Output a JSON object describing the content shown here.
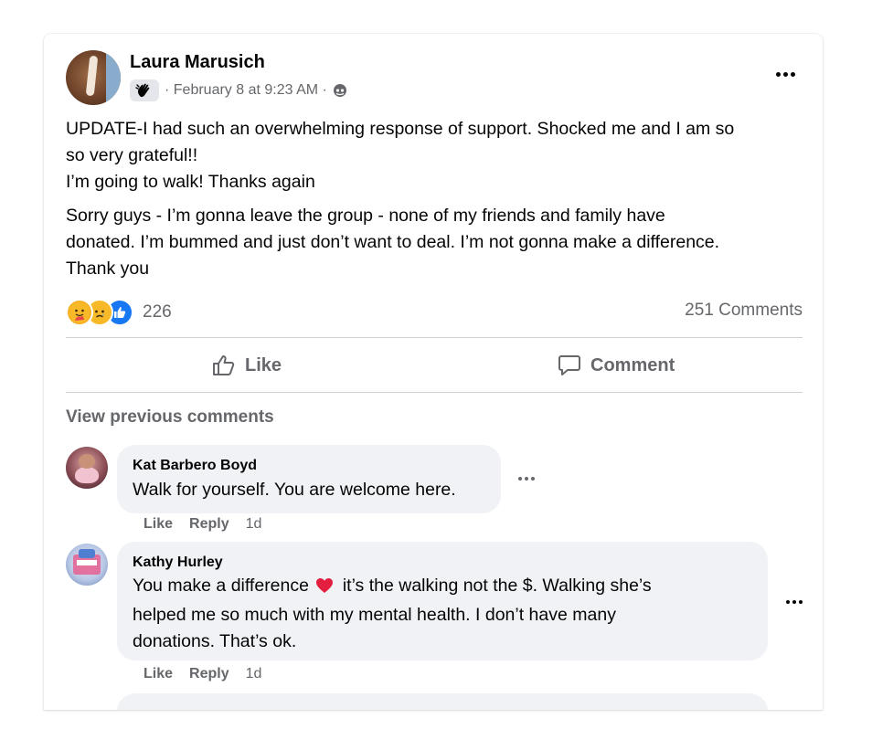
{
  "post": {
    "author": "Laura Marusich",
    "badge_icon": "waving-hand-icon",
    "meta": "· February 8 at 9:23 AM ·",
    "audience_icon": "globe-icon",
    "text": {
      "update_line1": "UPDATE-I had such an overwhelming response of support. Shocked me and I am so",
      "update_line2": "so very grateful!!",
      "update_line3": "I’m going to walk! Thanks again",
      "body_line1": "Sorry guys - I’m gonna leave the group - none of my friends and family have",
      "body_line2": "donated. I’m bummed and just don’t want to deal. I’m not gonna make a difference.",
      "body_line3": "Thank you"
    },
    "reactions": {
      "icons": [
        "care-icon",
        "sad-icon",
        "like-icon"
      ],
      "count": "226"
    },
    "comments_count": "251 Comments"
  },
  "actions": {
    "like_label": "Like",
    "comment_label": "Comment"
  },
  "comments_section": {
    "view_previous": "View previous comments",
    "items": [
      {
        "author": "Kat Barbero Boyd",
        "text_line1": "Walk for yourself. You are welcome here.",
        "like": "Like",
        "reply": "Reply",
        "time": "1d"
      },
      {
        "author": "Kathy Hurley",
        "text_part1": "You make a difference",
        "emoji": "red-heart-icon",
        "text_part2": "it’s the walking not the $. Walking she’s",
        "text_line2": "helped me so much with my mental health. I don’t have many",
        "text_line3": "donations. That’s ok.",
        "like": "Like",
        "reply": "Reply",
        "time": "1d"
      }
    ]
  },
  "colors": {
    "text_primary": "#050505",
    "text_secondary": "#65676b",
    "bubble": "#f0f2f5",
    "like_blue": "#1877f2",
    "heart_red": "#e41e3f"
  }
}
